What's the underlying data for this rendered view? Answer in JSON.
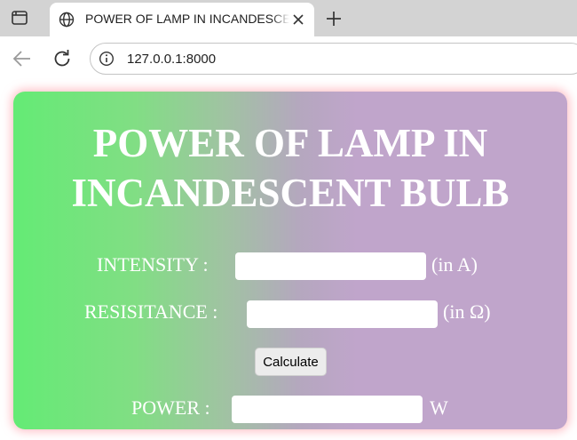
{
  "browser": {
    "tab_title": "POWER OF LAMP IN INCANDESCENT BULB",
    "url": "127.0.0.1:8000"
  },
  "page": {
    "title_line1": "POWER OF LAMP IN",
    "title_line2": "INCANDESCENT BULB",
    "intensity": {
      "label": "INTENSITY :",
      "value": "",
      "unit": "(in A)"
    },
    "resistance": {
      "label": "RESISITANCE :",
      "value": "",
      "unit": "(in Ω)"
    },
    "calculate_label": "Calculate",
    "power": {
      "label": "POWER :",
      "value": "",
      "unit": "W"
    }
  }
}
